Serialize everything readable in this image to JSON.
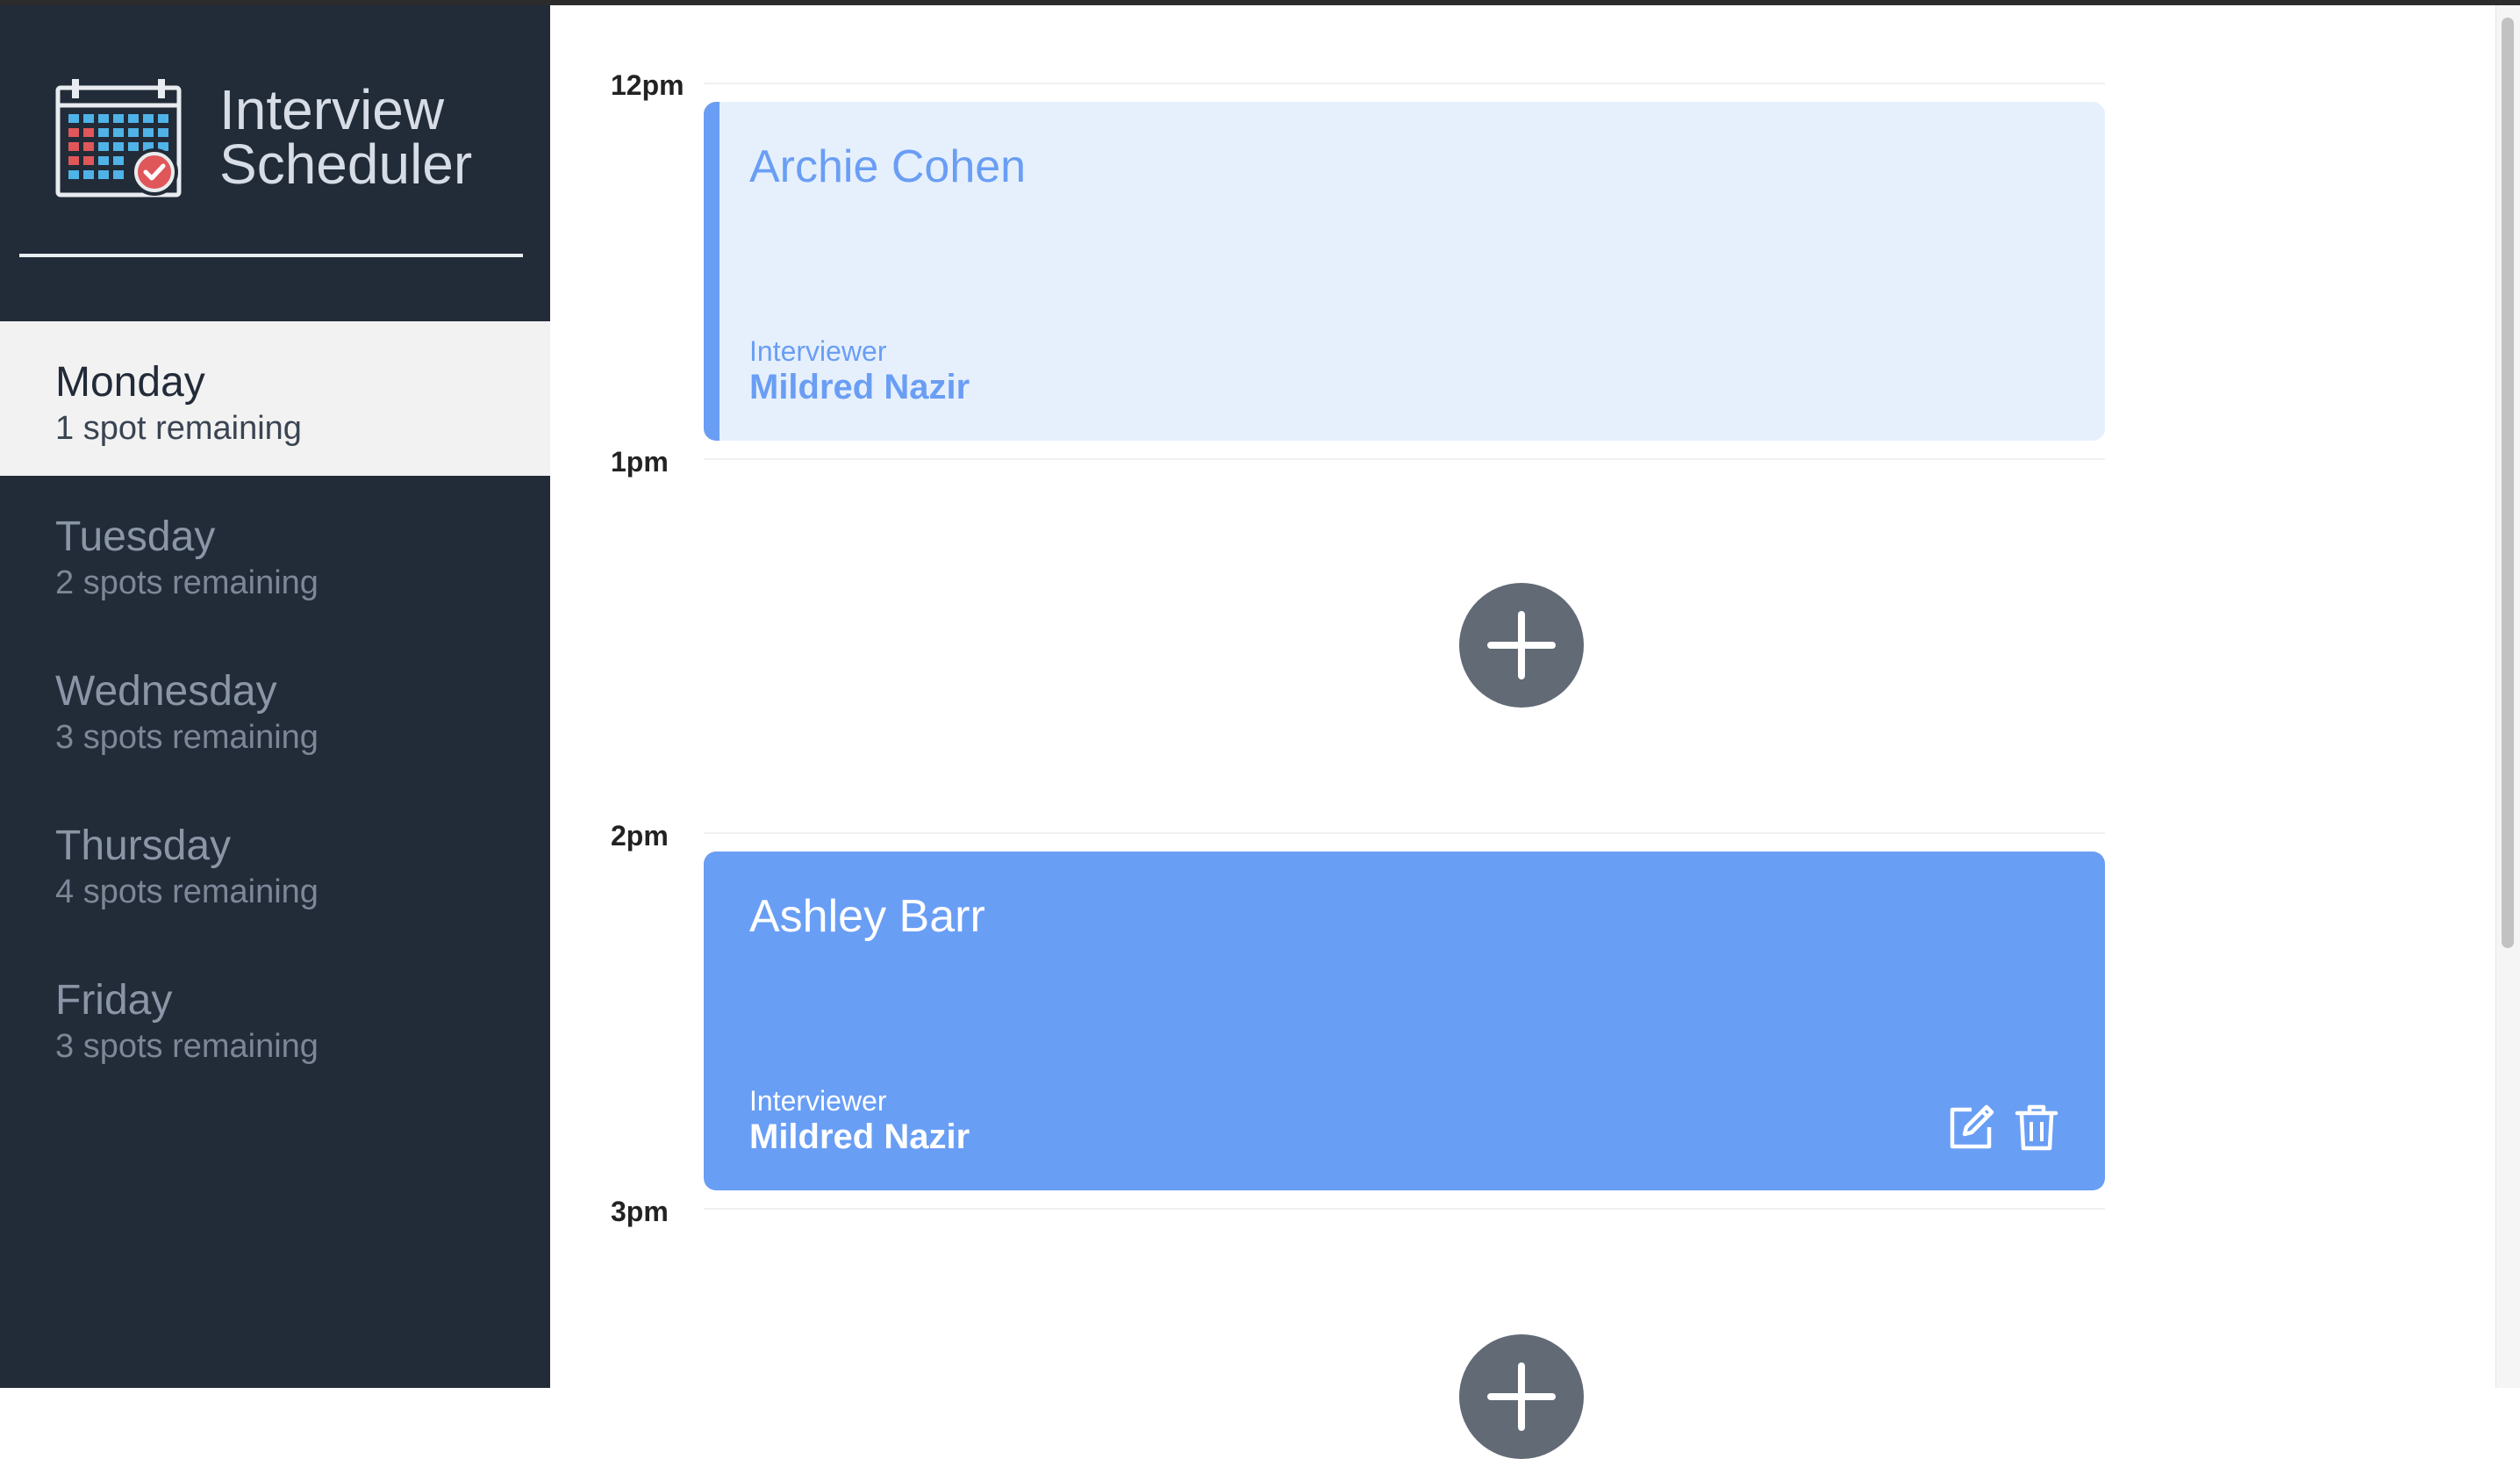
{
  "app": {
    "title_line1": "Interview",
    "title_line2": "Scheduler"
  },
  "sidebar": {
    "days": [
      {
        "name": "Monday",
        "spots": "1 spot remaining",
        "selected": true
      },
      {
        "name": "Tuesday",
        "spots": "2 spots remaining",
        "selected": false
      },
      {
        "name": "Wednesday",
        "spots": "3 spots remaining",
        "selected": false
      },
      {
        "name": "Thursday",
        "spots": "4 spots remaining",
        "selected": false
      },
      {
        "name": "Friday",
        "spots": "3 spots remaining",
        "selected": false
      }
    ]
  },
  "schedule": {
    "times": [
      "12pm",
      "1pm",
      "2pm",
      "3pm"
    ],
    "appointments": [
      {
        "student": "Archie Cohen",
        "interviewer_label": "Interviewer",
        "interviewer": "Mildred Nazir",
        "style": "light"
      },
      {
        "student": "Ashley Barr",
        "interviewer_label": "Interviewer",
        "interviewer": "Mildred Nazir",
        "style": "solid"
      }
    ]
  },
  "icons": {
    "logo": "calendar-check-icon",
    "add": "plus-icon",
    "edit": "edit-icon",
    "delete": "trash-icon"
  },
  "colors": {
    "sidebar_bg": "#222b38",
    "accent": "#699ef5",
    "appointment_light": "#e6f0fd",
    "add_button": "#616a75"
  }
}
